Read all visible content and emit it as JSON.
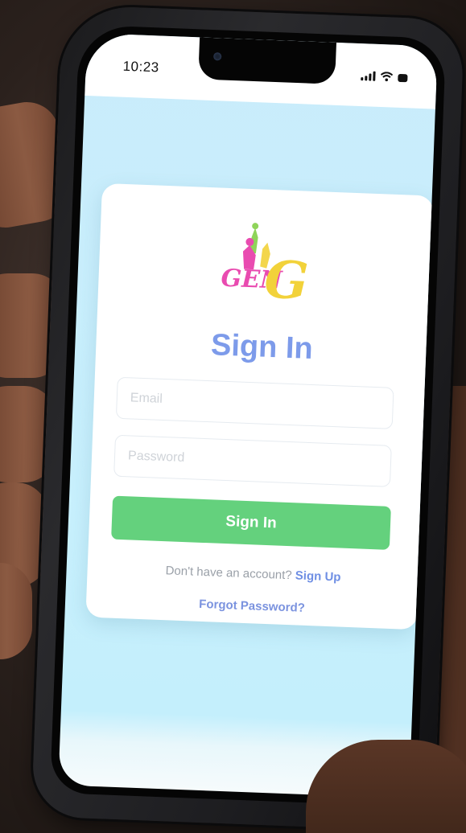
{
  "status_bar": {
    "time": "10:23"
  },
  "signin": {
    "title": "Sign In",
    "email_placeholder": "Email",
    "password_placeholder": "Password",
    "button_label": "Sign In",
    "no_account_text": "Don't have an account?",
    "signup_link": "Sign Up",
    "forgot_password": "Forgot Password?"
  },
  "logo": {
    "text": "GenG"
  },
  "colors": {
    "accent_blue": "#7d9bea",
    "button_green": "#64d17d",
    "screen_bg": "#c9ecfb",
    "logo_pink": "#e94bb0",
    "logo_yellow": "#f2d23a",
    "logo_green": "#8fd45a"
  }
}
